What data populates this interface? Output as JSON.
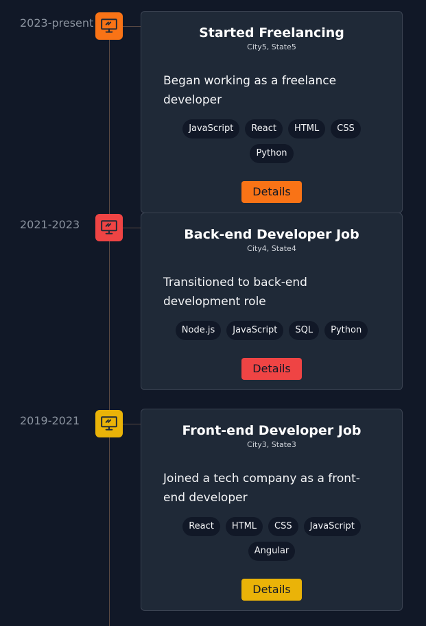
{
  "timeline": {
    "entries": [
      {
        "date": "2023-present",
        "title": "Started Freelancing",
        "location": "City5, State5",
        "description": "Began working as a freelance developer",
        "tags": [
          "JavaScript",
          "React",
          "HTML",
          "CSS",
          "Python"
        ],
        "button": "Details",
        "icon": "monitor-icon",
        "color": "#f97316"
      },
      {
        "date": "2021-2023",
        "title": "Back-end Developer Job",
        "location": "City4, State4",
        "description": "Transitioned to back-end development role",
        "tags": [
          "Node.js",
          "JavaScript",
          "SQL",
          "Python"
        ],
        "button": "Details",
        "icon": "monitor-icon",
        "color": "#ef4444"
      },
      {
        "date": "2019-2021",
        "title": "Front-end Developer Job",
        "location": "City3, State3",
        "description": "Joined a tech company as a front-end developer",
        "tags": [
          "React",
          "HTML",
          "CSS",
          "JavaScript",
          "Angular"
        ],
        "button": "Details",
        "icon": "monitor-icon",
        "color": "#eab308"
      }
    ]
  }
}
